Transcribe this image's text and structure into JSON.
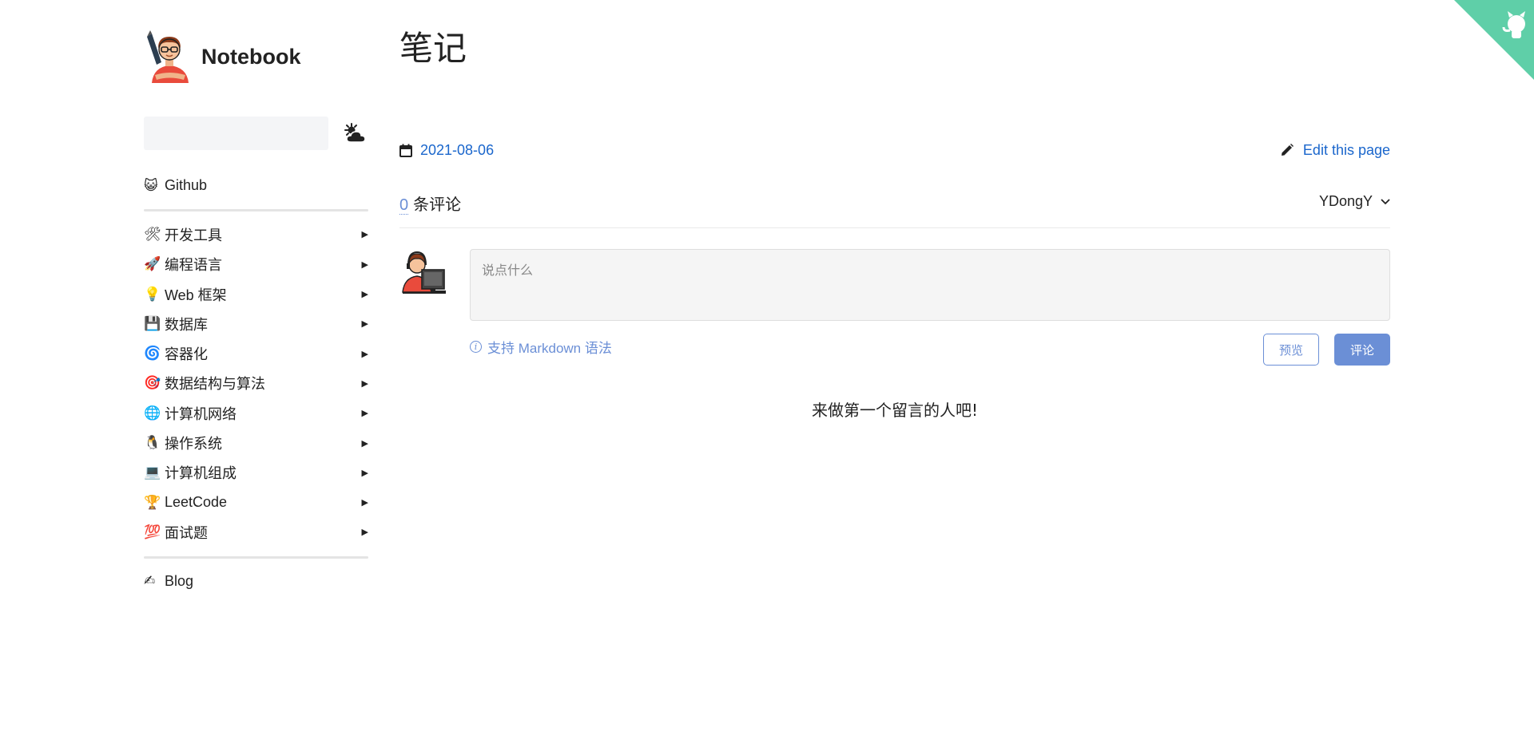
{
  "colors": {
    "accent": "#1a66cc",
    "soft_accent": "#6b8fd6",
    "corner": "#5fcfa8"
  },
  "github_corner": {
    "icon": "octocat-icon"
  },
  "brand": {
    "title": "Notebook",
    "logo_icon": "developer-avatar-icon"
  },
  "search": {
    "placeholder": ""
  },
  "theme_toggle": {
    "icon": "sun-cloud-icon"
  },
  "sidebar": {
    "top_links": [
      {
        "emoji": "😺",
        "label": "Github"
      }
    ],
    "sections": [
      {
        "emoji": "🛠",
        "label": "开发工具",
        "arrow": "▶"
      },
      {
        "emoji": "🚀",
        "label": "编程语言",
        "arrow": "▶"
      },
      {
        "emoji": "💡",
        "label": "Web 框架",
        "arrow": "▶"
      },
      {
        "emoji": "💾",
        "label": "数据库",
        "arrow": "▶"
      },
      {
        "emoji": "🌀",
        "label": "容器化",
        "arrow": "▶"
      },
      {
        "emoji": "🎯",
        "label": "数据结构与算法",
        "arrow": "▶"
      },
      {
        "emoji": "🌐",
        "label": "计算机网络",
        "arrow": "▶"
      },
      {
        "emoji": "🐧",
        "label": "操作系统",
        "arrow": "▶"
      },
      {
        "emoji": "💻",
        "label": "计算机组成",
        "arrow": "▶"
      },
      {
        "emoji": "🏆",
        "label": "LeetCode",
        "arrow": "▶"
      },
      {
        "emoji": "💯",
        "label": "面试题",
        "arrow": "▶"
      }
    ],
    "bottom_links": [
      {
        "emoji": "✍",
        "label": "Blog"
      }
    ]
  },
  "page": {
    "title": "笔记",
    "date": "2021-08-06",
    "edit_label": "Edit this page"
  },
  "comments": {
    "count": "0",
    "count_suffix": "条评论",
    "user": "YDongY",
    "placeholder": "说点什么",
    "markdown_hint": "支持 Markdown 语法",
    "info_glyph": "i",
    "preview_label": "预览",
    "submit_label": "评论",
    "empty_message": "来做第一个留言的人吧!"
  }
}
